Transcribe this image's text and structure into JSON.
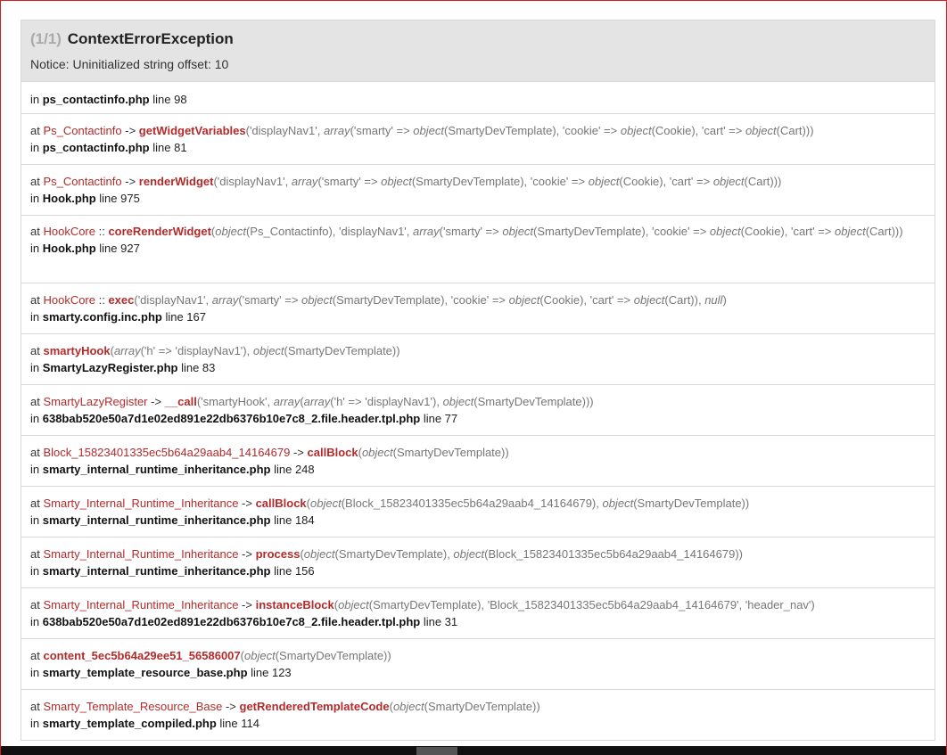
{
  "exception": {
    "count": "(1/1)",
    "name": "ContextErrorException",
    "message": "Notice: Uninitialized string offset: 10"
  },
  "trace": [
    {
      "type": "first",
      "file": "ps_contactinfo.php",
      "line": "line 98"
    },
    {
      "type": "call",
      "at": "at",
      "cls": "Ps_Contactinfo",
      "arrow": "->",
      "fn": "getWidgetVariables",
      "args": "('displayNav1', array('smarty' => object(SmartyDevTemplate), 'cookie' => object(Cookie), 'cart' => object(Cart)))",
      "file": "ps_contactinfo.php",
      "line": "line 81"
    },
    {
      "type": "call",
      "at": "at",
      "cls": "Ps_Contactinfo",
      "arrow": "->",
      "fn": "renderWidget",
      "args": "('displayNav1', array('smarty' => object(SmartyDevTemplate), 'cookie' => object(Cookie), 'cart' => object(Cart)))",
      "file": "Hook.php",
      "line": "line 975"
    },
    {
      "type": "call",
      "at": "at",
      "cls": "HookCore",
      "arrow": "::",
      "fn": "coreRenderWidget",
      "args": "(object(Ps_Contactinfo), 'displayNav1', array('smarty' => object(SmartyDevTemplate), 'cookie' => object(Cookie), 'cart' => object(Cart)))",
      "file": "Hook.php",
      "line": "line 927"
    },
    {
      "type": "call",
      "at": "at",
      "cls": "HookCore",
      "arrow": "::",
      "fn": "exec",
      "args": "('displayNav1', array('smarty' => object(SmartyDevTemplate), 'cookie' => object(Cookie), 'cart' => object(Cart)), null)",
      "file": "smarty.config.inc.php",
      "line": "line 167"
    },
    {
      "type": "call",
      "at": "at",
      "cls": "",
      "arrow": "",
      "fn": "smartyHook",
      "args": "(array('h' => 'displayNav1'), object(SmartyDevTemplate))",
      "file": "SmartyLazyRegister.php",
      "line": "line 83"
    },
    {
      "type": "call",
      "at": "at",
      "cls": "SmartyLazyRegister",
      "arrow": "->",
      "fn": "__call",
      "args": "('smartyHook', array(array('h' => 'displayNav1'), object(SmartyDevTemplate)))",
      "file": "638bab520e50a7d1e02ed891e22db6376b10e7c8_2.file.header.tpl.php",
      "line": "line 77"
    },
    {
      "type": "call",
      "at": "at",
      "cls": "Block_15823401335ec5b64a29aab4_14164679",
      "arrow": "->",
      "fn": "callBlock",
      "args": "(object(SmartyDevTemplate))",
      "file": "smarty_internal_runtime_inheritance.php",
      "line": "line 248"
    },
    {
      "type": "call",
      "at": "at",
      "cls": "Smarty_Internal_Runtime_Inheritance",
      "arrow": "->",
      "fn": "callBlock",
      "args": "(object(Block_15823401335ec5b64a29aab4_14164679), object(SmartyDevTemplate))",
      "file": "smarty_internal_runtime_inheritance.php",
      "line": "line 184"
    },
    {
      "type": "call",
      "at": "at",
      "cls": "Smarty_Internal_Runtime_Inheritance",
      "arrow": "->",
      "fn": "process",
      "args": "(object(SmartyDevTemplate), object(Block_15823401335ec5b64a29aab4_14164679))",
      "file": "smarty_internal_runtime_inheritance.php",
      "line": "line 156"
    },
    {
      "type": "call",
      "at": "at",
      "cls": "Smarty_Internal_Runtime_Inheritance",
      "arrow": "->",
      "fn": "instanceBlock",
      "args": "(object(SmartyDevTemplate), 'Block_15823401335ec5b64a29aab4_14164679', 'header_nav')",
      "file": "638bab520e50a7d1e02ed891e22db6376b10e7c8_2.file.header.tpl.php",
      "line": "line 31"
    },
    {
      "type": "call",
      "at": "at",
      "cls": "",
      "arrow": "",
      "fn": "content_5ec5b64a29ee51_56586007",
      "args": "(object(SmartyDevTemplate))",
      "file": "smarty_template_resource_base.php",
      "line": "line 123"
    },
    {
      "type": "call",
      "at": "at",
      "cls": "Smarty_Template_Resource_Base",
      "arrow": "->",
      "fn": "getRenderedTemplateCode",
      "args": "(object(SmartyDevTemplate))",
      "file": "smarty_template_compiled.php",
      "line": "line 114"
    }
  ],
  "in_label": "in"
}
